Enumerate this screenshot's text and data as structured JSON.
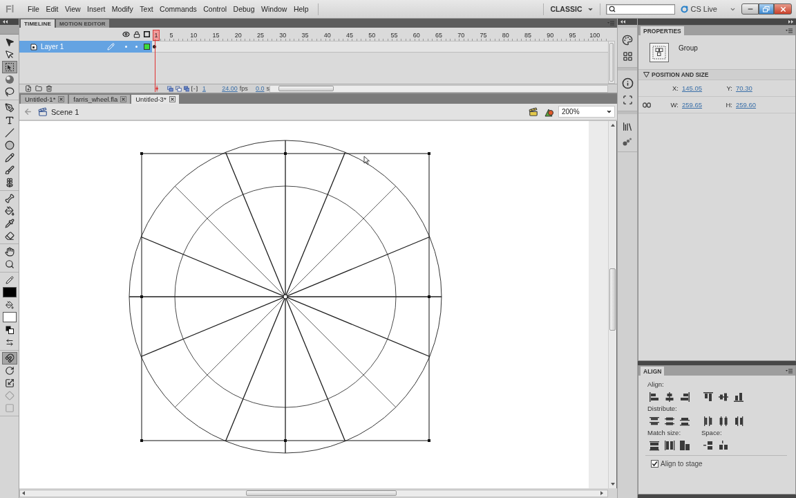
{
  "app_bar": {
    "logo": "Fl",
    "menu": [
      "File",
      "Edit",
      "View",
      "Insert",
      "Modify",
      "Text",
      "Commands",
      "Control",
      "Debug",
      "Window",
      "Help"
    ],
    "workspace": "CLASSIC",
    "cs_live": "CS Live"
  },
  "tool_groups": [
    [
      {
        "kind": "selection",
        "selected": false,
        "disabled": false
      },
      {
        "kind": "subselection",
        "selected": false,
        "disabled": false
      },
      {
        "kind": "transform",
        "selected": true,
        "disabled": false
      },
      {
        "kind": "rotation",
        "selected": false,
        "disabled": false
      },
      {
        "kind": "lasso",
        "selected": false,
        "disabled": false
      }
    ],
    [
      {
        "kind": "pen",
        "selected": false,
        "disabled": false
      },
      {
        "kind": "text",
        "selected": false,
        "disabled": false
      },
      {
        "kind": "line",
        "selected": false,
        "disabled": false
      },
      {
        "kind": "oval",
        "selected": false,
        "disabled": false
      },
      {
        "kind": "pencil",
        "selected": false,
        "disabled": false
      },
      {
        "kind": "brush",
        "selected": false,
        "disabled": false
      },
      {
        "kind": "deco",
        "selected": false,
        "disabled": false
      }
    ],
    [
      {
        "kind": "bone",
        "selected": false,
        "disabled": false
      },
      {
        "kind": "bucket",
        "selected": false,
        "disabled": false
      },
      {
        "kind": "eyedropper",
        "selected": false,
        "disabled": false
      },
      {
        "kind": "eraser",
        "selected": false,
        "disabled": false
      }
    ],
    [
      {
        "kind": "hand",
        "selected": false,
        "disabled": false
      },
      {
        "kind": "zoom",
        "selected": false,
        "disabled": false
      }
    ],
    [
      {
        "kind": "stroke",
        "selected": false,
        "disabled": false
      },
      {
        "kind": "swatch",
        "color": "#000000",
        "selected": false,
        "disabled": false
      },
      {
        "kind": "fill",
        "selected": false,
        "disabled": false
      },
      {
        "kind": "swatch",
        "color": "#ffffff",
        "selected": false,
        "disabled": false
      },
      {
        "kind": "defaults",
        "selected": false,
        "disabled": false
      },
      {
        "kind": "swap",
        "selected": false,
        "disabled": false
      }
    ],
    [
      {
        "kind": "snap",
        "selected": true,
        "disabled": false
      },
      {
        "kind": "rotate",
        "selected": false,
        "disabled": false
      },
      {
        "kind": "scale",
        "selected": false,
        "disabled": false
      },
      {
        "kind": "distort",
        "selected": false,
        "disabled": true
      },
      {
        "kind": "envelope",
        "selected": false,
        "disabled": true
      }
    ]
  ],
  "timeline": {
    "tabs": [
      {
        "label": "TIMELINE",
        "selected": true
      },
      {
        "label": "MOTION EDITOR",
        "selected": false
      }
    ],
    "frames": [
      {
        "label": "1",
        "selected": true
      },
      {
        "label": "5",
        "selected": false
      },
      {
        "label": "10",
        "selected": false
      },
      {
        "label": "15",
        "selected": false
      },
      {
        "label": "20",
        "selected": false
      },
      {
        "label": "25",
        "selected": false
      },
      {
        "label": "30",
        "selected": false
      },
      {
        "label": "35",
        "selected": false
      },
      {
        "label": "40",
        "selected": false
      },
      {
        "label": "45",
        "selected": false
      },
      {
        "label": "50",
        "selected": false
      },
      {
        "label": "55",
        "selected": false
      },
      {
        "label": "60",
        "selected": false
      },
      {
        "label": "65",
        "selected": false
      },
      {
        "label": "70",
        "selected": false
      },
      {
        "label": "75",
        "selected": false
      },
      {
        "label": "80",
        "selected": false
      },
      {
        "label": "85",
        "selected": false
      },
      {
        "label": "90",
        "selected": false
      },
      {
        "label": "95",
        "selected": false
      },
      {
        "label": "100",
        "selected": false
      }
    ],
    "layers": [
      {
        "name": "Layer 1",
        "selected": true,
        "color": "#3ddc3d"
      }
    ],
    "current_frame": "1",
    "fps": "24.00",
    "fps_unit": "fps",
    "elapsed": "0.0",
    "elapsed_unit": "s"
  },
  "documents": [
    {
      "label": "Untitled-1*",
      "selected": false
    },
    {
      "label": "farris_wheel.fla",
      "selected": false
    },
    {
      "label": "Untitled-3*",
      "selected": true
    }
  ],
  "edit_bar": {
    "scene": "Scene 1",
    "zoom": "200%"
  },
  "properties": {
    "title": "PROPERTIES",
    "object_type": "Group",
    "section": {
      "title": "POSITION AND SIZE",
      "expanded": true,
      "rows": [
        {
          "kind": "position",
          "fields": [
            {
              "label": "X:",
              "value": "145.05"
            },
            {
              "label": "Y:",
              "value": "70.30"
            }
          ]
        },
        {
          "kind": "size",
          "fields": [
            {
              "label": "W:",
              "value": "259.65"
            },
            {
              "label": "H:",
              "value": "259.60"
            }
          ]
        }
      ]
    }
  },
  "align": {
    "title": "ALIGN",
    "sections": [
      {
        "kind": "align",
        "label": "Align:"
      },
      {
        "kind": "distribute",
        "label": "Distribute:"
      },
      {
        "kind": "match",
        "label": "Match size:"
      },
      {
        "kind": "space",
        "label": "Space:"
      }
    ],
    "to_stage": {
      "label": "Align to stage",
      "checked": true
    }
  }
}
